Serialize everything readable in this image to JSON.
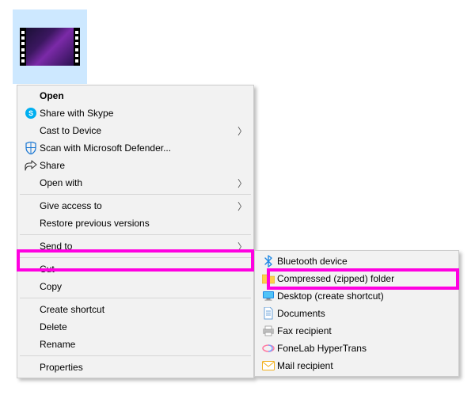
{
  "file": {
    "type": "video"
  },
  "menu": {
    "open": "Open",
    "share_skype": "Share with Skype",
    "cast": "Cast to Device",
    "scan_defender": "Scan with Microsoft Defender...",
    "share": "Share",
    "open_with": "Open with",
    "give_access": "Give access to",
    "restore": "Restore previous versions",
    "send_to": "Send to",
    "cut": "Cut",
    "copy": "Copy",
    "create_shortcut": "Create shortcut",
    "delete": "Delete",
    "rename": "Rename",
    "properties": "Properties"
  },
  "submenu": {
    "bluetooth": "Bluetooth device",
    "compressed": "Compressed (zipped) folder",
    "desktop_shortcut": "Desktop (create shortcut)",
    "documents": "Documents",
    "fax": "Fax recipient",
    "fonelab": "FoneLab HyperTrans",
    "mail": "Mail recipient"
  },
  "highlight": {
    "color": "#ff00e1",
    "primary": "send_to",
    "secondary": "compressed"
  }
}
